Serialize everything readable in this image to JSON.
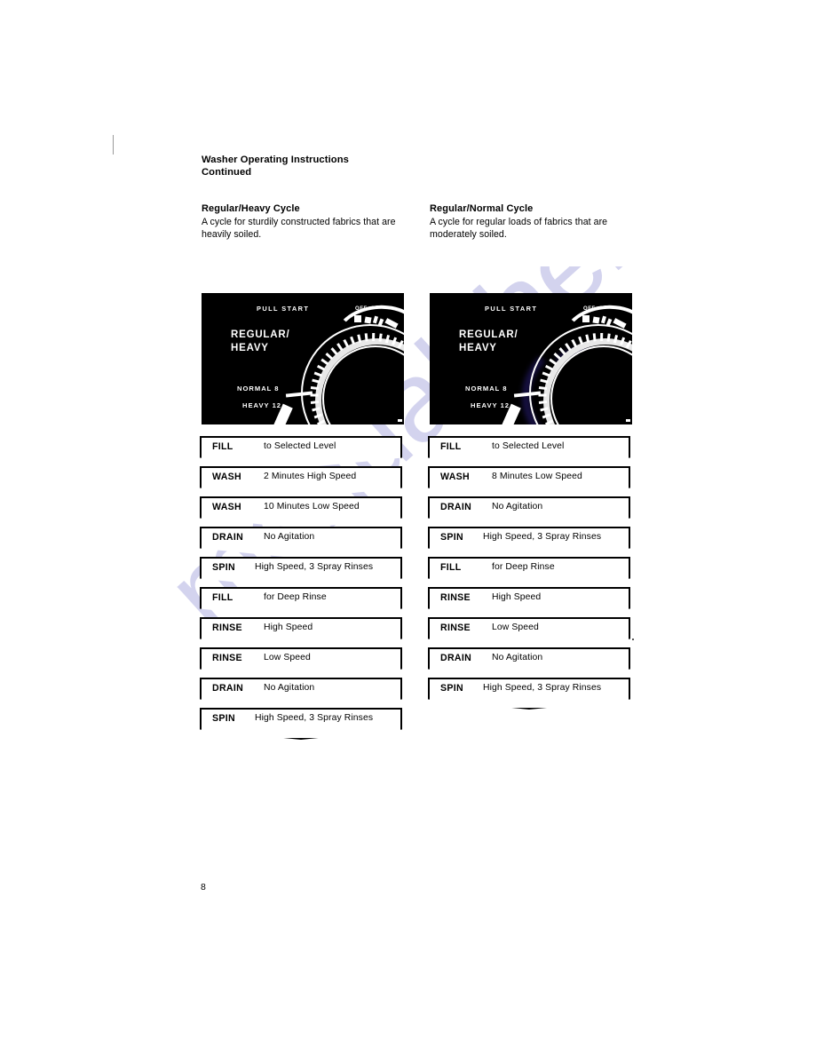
{
  "document": {
    "header_line1": "Washer Operating Instructions",
    "header_line2": "Continued",
    "page_number": "8",
    "watermark": "manualshelf.com"
  },
  "columns": [
    {
      "title": "Regular/Heavy Cycle",
      "description": "A cycle for sturdily constructed fabrics that are heavily soiled.",
      "panel": {
        "pull_start": "PULL START",
        "off": "OFF",
        "cycle_name_line1": "REGULAR/",
        "cycle_name_line2": "HEAVY",
        "setting_normal": "NORMAL  8",
        "setting_heavy": "HEAVY  12"
      },
      "steps": [
        {
          "label": "FILL",
          "detail": "to Selected Level"
        },
        {
          "label": "WASH",
          "detail": "2 Minutes High Speed"
        },
        {
          "label": "WASH",
          "detail": "10 Minutes Low Speed"
        },
        {
          "label": "DRAIN",
          "detail": "No Agitation"
        },
        {
          "label": "SPIN",
          "detail": "High Speed, 3 Spray Rinses"
        },
        {
          "label": "FILL",
          "detail": "for Deep Rinse"
        },
        {
          "label": "RINSE",
          "detail": "High Speed"
        },
        {
          "label": "RINSE",
          "detail": "Low Speed"
        },
        {
          "label": "DRAIN",
          "detail": "No Agitation"
        },
        {
          "label": "SPIN",
          "detail": "High Speed, 3 Spray Rinses"
        }
      ]
    },
    {
      "title": "Regular/Normal Cycle",
      "description": "A cycle for regular loads of fabrics that are moderately soiled.",
      "panel": {
        "pull_start": "PULL START",
        "off": "OFF",
        "cycle_name_line1": "REGULAR/",
        "cycle_name_line2": "HEAVY",
        "setting_normal": "NORMAL  8",
        "setting_heavy": "HEAVY  12"
      },
      "steps": [
        {
          "label": "FILL",
          "detail": "to Selected Level"
        },
        {
          "label": "WASH",
          "detail": "8 Minutes Low Speed"
        },
        {
          "label": "DRAIN",
          "detail": "No Agitation"
        },
        {
          "label": "SPIN",
          "detail": "High Speed, 3 Spray Rinses"
        },
        {
          "label": "FILL",
          "detail": "for Deep Rinse"
        },
        {
          "label": "RINSE",
          "detail": "High Speed"
        },
        {
          "label": "RINSE",
          "detail": "Low Speed"
        },
        {
          "label": "DRAIN",
          "detail": "No Agitation"
        },
        {
          "label": "SPIN",
          "detail": "High Speed, 3 Spray Rinses"
        }
      ]
    }
  ]
}
